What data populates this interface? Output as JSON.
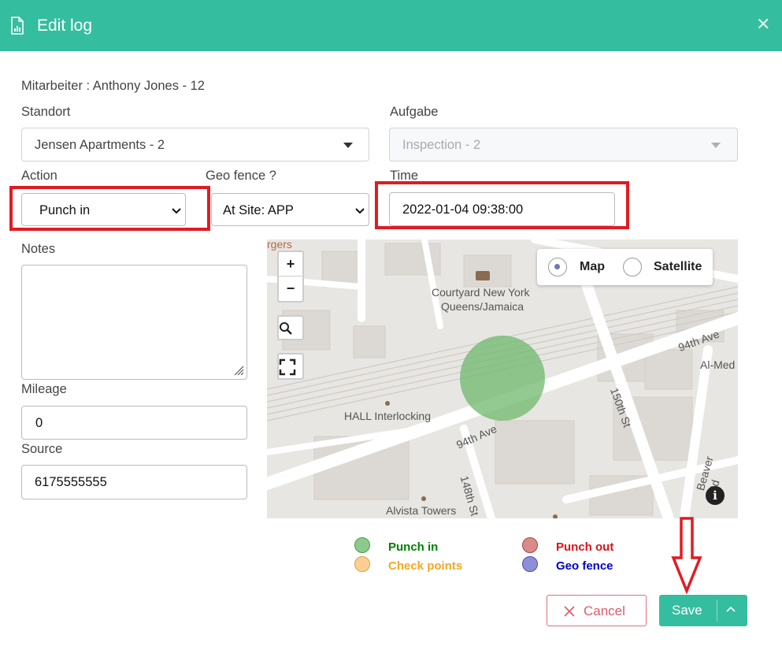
{
  "dialog": {
    "title": "Edit log",
    "close_glyph": "✕",
    "header_color": "#35bd9f"
  },
  "form": {
    "employee_line": "Mitarbeiter : Anthony Jones - 12",
    "location_label": "Standort",
    "location_value": "Jensen Apartments - 2",
    "task_label": "Aufgabe",
    "task_value": "Inspection - 2",
    "action_label": "Action",
    "action_value": "Punch in",
    "geofence_label": "Geo fence ?",
    "geofence_value": "At Site: APP",
    "time_label": "Time",
    "time_value": "2022-01-04 09:38:00",
    "notes_label": "Notes",
    "notes_value": "",
    "mileage_label": "Mileage",
    "mileage_value": "0",
    "source_label": "Source",
    "source_value": "6175555555"
  },
  "map": {
    "type_options": [
      "Map",
      "Satellite"
    ],
    "selected_type": "Map",
    "zoom_in": "+",
    "zoom_out": "−",
    "labels": {
      "poi1_line1": "Courtyard New York",
      "poi1_line2": "Queens/Jamaica",
      "poi2": "HALL Interlocking",
      "poi3": "Alvista Towers",
      "street1": "94th Ave",
      "street2": "94th Ave",
      "street3": "150th St",
      "street4": "148th St",
      "street5": "Beaver Rd",
      "place1": "Al-Med",
      "place2": "rgers"
    }
  },
  "legend": [
    {
      "label": "Punch in",
      "color": "#008000",
      "dot": "#8cc98c"
    },
    {
      "label": "Punch out",
      "color": "#e0101a",
      "dot": "#d98a8a"
    },
    {
      "label": "Check points",
      "color": "#f5a623",
      "dot": "#fbcf8f"
    },
    {
      "label": "Geo fence",
      "color": "#0000d0",
      "dot": "#8f8fd6"
    }
  ],
  "buttons": {
    "cancel": "Cancel",
    "save": "Save"
  }
}
